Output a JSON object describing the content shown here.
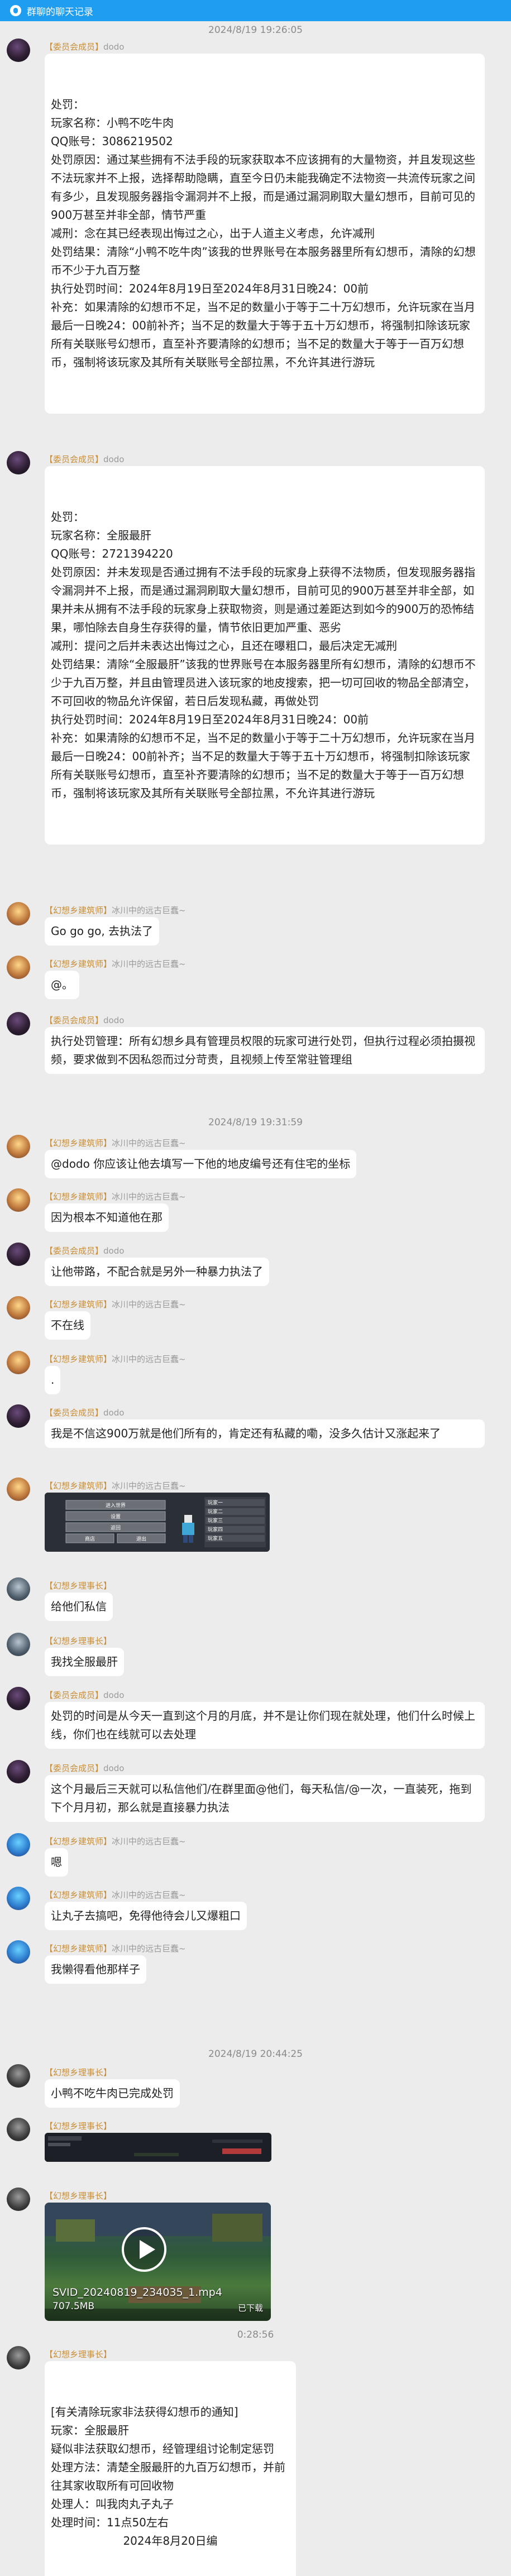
{
  "window": {
    "title": "群聊的聊天记录"
  },
  "timestamps": [
    "2024/8/19 19:26:05",
    "2024/8/19 19:31:59",
    "2024/8/19 20:44:25",
    "0:28:56"
  ],
  "senders": {
    "dodo": {
      "tag": "【委员会成员】",
      "name": "dodo"
    },
    "m1": {
      "tag": "【幻想乡建筑师】",
      "name": "冰川中的远古巨蠢~"
    },
    "m2": {
      "tag": "【幻想乡理事长】",
      "name": "　"
    },
    "m3": {
      "tag": "【幻想乡建筑师】",
      "name": "冰川中的远古巨蠢~"
    },
    "m4": {
      "tag": "【幻想乡理事长】",
      "name": ""
    }
  },
  "messages": [
    {
      "lines": [
        "处罚：",
        "玩家名称：小鸭不吃牛肉",
        "QQ账号：3086219502",
        "处罚原因：通过某些拥有不法手段的玩家获取本不应该拥有的大量物资，并且发现这些不法玩家并不上报，选择帮助隐瞒，直至今日仍未能我确定不法物资一共流传玩家之间有多少，且发现服务器指令漏洞并不上报，而是通过漏洞刷取大量幻想币，目前可见的900万甚至并非全部，情节严重",
        "减刑：念在其已经表现出悔过之心，出于人道主义考虑，允许减刑",
        "处罚结果：清除“小鸭不吃牛肉”该我的世界账号在本服务器里所有幻想币，清除的幻想币不少于九百万整",
        "执行处罚时间：2024年8月19日至2024年8月31日晚24：00前",
        "补充：如果清除的幻想币不足，当不足的数量小于等于二十万幻想币，允许玩家在当月最后一日晚24：00前补齐；当不足的数量大于等于五十万幻想币，将强制扣除该玩家所有关联账号幻想币，直至补齐要清除的幻想币；当不足的数量大于等于一百万幻想币，强制将该玩家及其所有关联账号全部拉黑，不允许其进行游玩"
      ]
    },
    {
      "lines": [
        "处罚：",
        "玩家名称：全服最肝",
        "QQ账号：2721394220",
        "处罚原因：并未发现是否通过拥有不法手段的玩家身上获得不法物质，但发现服务器指令漏洞并不上报，而是通过漏洞刷取大量幻想币，目前可见的900万甚至并非全部，如果并未从拥有不法手段的玩家身上获取物资，则是通过差距达到如今的900万的恐怖结果，哪怕除去自身生存获得的量，情节依旧更加严重、恶劣",
        "减刑：提问之后并未表达出悔过之心，且还在曝粗口，最后决定无减刑",
        "处罚结果：清除“全服最肝”该我的世界账号在本服务器里所有幻想币，清除的幻想币不少于九百万整，并且由管理员进入该玩家的地皮搜索，把一切可回收的物品全部清空，不可回收的物品允许保留，若日后发现私藏，再做处罚",
        "执行处罚时间：2024年8月19日至2024年8月31日晚24：00前",
        "补充：如果清除的幻想币不足，当不足的数量小于等于二十万幻想币，允许玩家在当月最后一日晚24：00前补齐；当不足的数量大于等于五十万幻想币，将强制扣除该玩家所有关联账号幻想币，直至补齐要清除的幻想币；当不足的数量大于等于一百万幻想币，强制将该玩家及其所有关联账号全部拉黑，不允许其进行游玩"
      ]
    },
    {
      "text": "Go go go, 去执法了"
    },
    {
      "text": "@。"
    },
    {
      "text": "执行处罚管理：所有幻想乡具有管理员权限的玩家可进行处罚，但执行过程必须拍摄视频，要求做到不因私怨而过分苛责，且视频上传至常驻管理组"
    },
    {
      "text": "@dodo 你应该让他去填写一下他的地皮编号还有住宅的坐标"
    },
    {
      "text": "因为根本不知道他在那"
    },
    {
      "text": "让他带路，不配合就是另外一种暴力执法了"
    },
    {
      "text": "不在线"
    },
    {
      "text": "."
    },
    {
      "text": "我是不信这900万就是他们所有的，肯定还有私藏的嘞，没多久估计又涨起来了"
    },
    {
      "text": "给他们私信"
    },
    {
      "text": "我找全服最肝"
    },
    {
      "text": "处罚的时间是从今天一直到这个月的月底，并不是让你们现在就处理，他们什么时候上线，你们也在线就可以去处理"
    },
    {
      "text": "这个月最后三天就可以私信他们/在群里面@他们，每天私信/@一次，一直装死，拖到下个月月初，那么就是直接暴力执法"
    },
    {
      "text": "嗯"
    },
    {
      "text": "让丸子去搞吧，免得他待会儿又爆粗口"
    },
    {
      "text": "我懒得看他那样子"
    },
    {
      "text": "小鸭不吃牛肉已完成处罚"
    },
    {
      "lines": [
        "[有关清除玩家非法获得幻想币的通知]",
        "玩家：全服最肝",
        "疑似非法获取幻想币，经管理组讨论制定惩罚",
        "处理方法：清楚全服最肝的九百万幻想币，并前往其家收取所有可回收物",
        "处理人：叫我肉丸子丸子",
        "处理时间：11点50左右",
        "2024年8月20日编"
      ]
    }
  ],
  "screenshot1": {
    "menu_items": [
      "进入世界",
      "设置",
      "返回",
      "商店",
      "退出"
    ],
    "panel_rows": [
      "玩家一",
      "玩家二",
      "玩家三",
      "玩家四",
      "玩家五"
    ]
  },
  "video": {
    "filename": "SVID_20240819_234035_1.mp4",
    "size": "707.5MB",
    "status": "已下载"
  }
}
